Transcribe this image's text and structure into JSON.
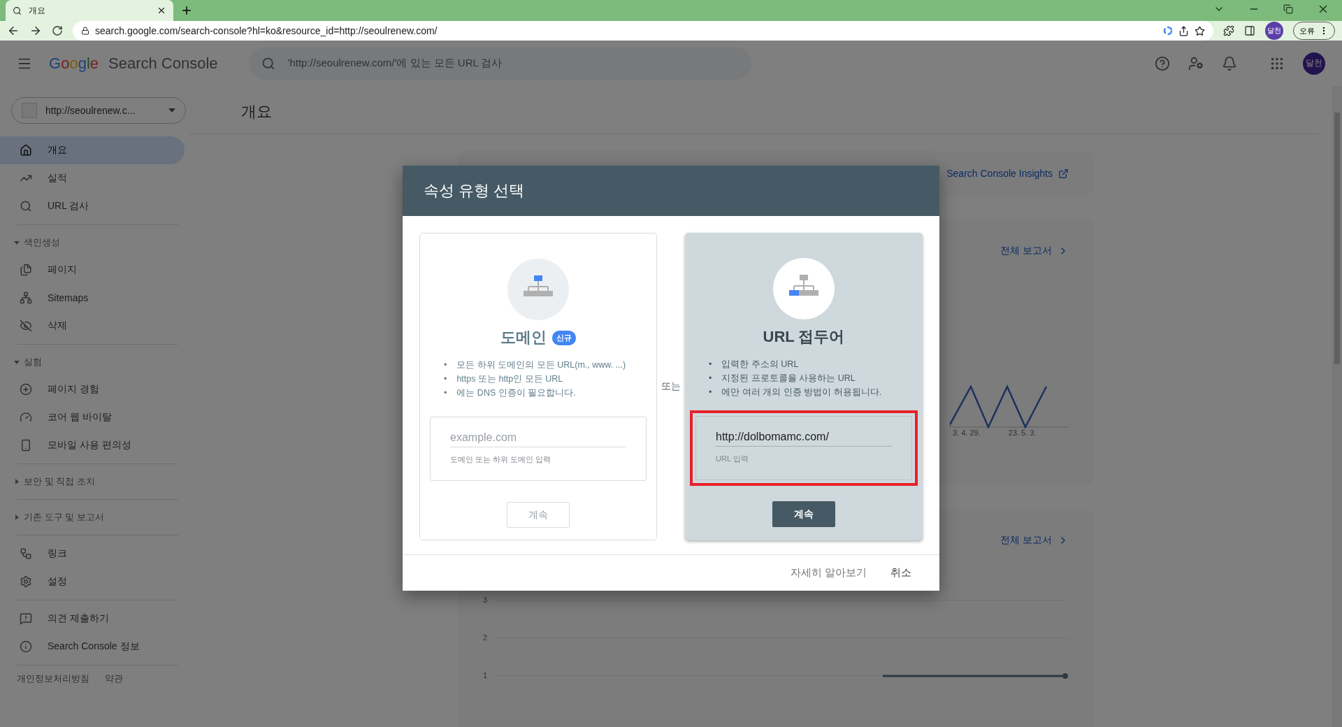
{
  "browser": {
    "tab_title": "개요",
    "url": "search.google.com/search-console?hl=ko&resource_id=http://seoulrenew.com/",
    "avatar": "달천",
    "profile_button": "오류"
  },
  "header": {
    "logo": "Google",
    "product": "Search Console",
    "search_placeholder": "'http://seoulrenew.com/'에 있는 모든 URL 검사",
    "avatar": "달천"
  },
  "sidebar": {
    "property": "http://seoulrenew.c...",
    "groups": [
      {
        "items": [
          {
            "label": "개요",
            "selected": true
          },
          {
            "label": "실적",
            "selected": false
          },
          {
            "label": "URL 검사",
            "selected": false
          }
        ]
      },
      {
        "heading": "색인생성",
        "expanded": true,
        "items": [
          {
            "label": "페이지",
            "selected": false
          },
          {
            "label": "Sitemaps",
            "selected": false
          },
          {
            "label": "삭제",
            "selected": false
          }
        ]
      },
      {
        "heading": "실험",
        "expanded": true,
        "items": [
          {
            "label": "페이지 경험",
            "selected": false
          },
          {
            "label": "코어 웹 바이탈",
            "selected": false
          },
          {
            "label": "모바일 사용 편의성",
            "selected": false
          }
        ]
      },
      {
        "heading": "보안 및 직접 조치",
        "expanded": false
      },
      {
        "heading": "기존 도구 및 보고서",
        "expanded": false
      },
      {
        "items": [
          {
            "label": "링크",
            "selected": false
          },
          {
            "label": "설정",
            "selected": false
          }
        ]
      },
      {
        "items": [
          {
            "label": "의견 제출하기",
            "selected": false
          },
          {
            "label": "Search Console 정보",
            "selected": false
          }
        ]
      }
    ],
    "footer_links": [
      "개인정보처리방침",
      "약관"
    ]
  },
  "page_title": "개요",
  "insights_link": "Search Console Insights",
  "report_cards": [
    {
      "link": "전체 보고서",
      "x_labels": [
        "3. 4. 29.",
        "23. 5. 3."
      ]
    },
    {
      "link": "전체 보고서",
      "y_labels": [
        "3",
        "2",
        "1"
      ]
    }
  ],
  "dialog": {
    "title": "속성 유형 선택",
    "separator": "또는",
    "bullet_marker": "•",
    "options": [
      {
        "title": "도메인",
        "badge": "신규",
        "selected": false,
        "bullets": [
          "모든 하위 도메인의 모든 URL(m., www. ...)",
          "https 또는 http인 모든 URL",
          "에는 DNS 인증이 필요합니다."
        ],
        "input": {
          "placeholder": "example.com",
          "helper": "도메인 또는 하위 도메인 입력",
          "highlighted": false
        },
        "button": "계속"
      },
      {
        "title": "URL 접두어",
        "selected": true,
        "bullets": [
          "입력한 주소의 URL",
          "지정된 프로토콜을 사용하는 URL",
          "에만 여러 개의 인증 방법이 허용됩니다."
        ],
        "input": {
          "value": "http://dolbomamc.com/",
          "helper": "URL 입력",
          "highlighted": true
        },
        "button": "계속"
      }
    ],
    "footer_buttons": [
      "자세히 알아보기",
      "취소"
    ]
  }
}
